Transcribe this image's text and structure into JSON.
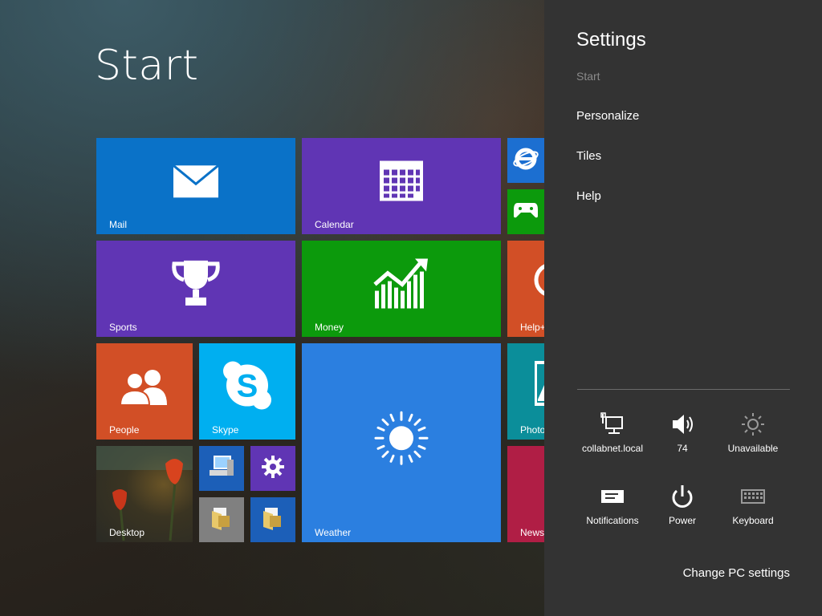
{
  "start": {
    "title": "Start"
  },
  "tiles": {
    "mail": {
      "label": "Mail",
      "color": "#0a72c8"
    },
    "calendar": {
      "label": "Calendar",
      "color": "#6035b4"
    },
    "sports": {
      "label": "Sports",
      "color": "#6035b4"
    },
    "money": {
      "label": "Money",
      "color": "#0c9a0c"
    },
    "people": {
      "label": "People",
      "color": "#d24f26"
    },
    "skype": {
      "label": "Skype",
      "color": "#00aff0"
    },
    "weather": {
      "label": "Weather",
      "color": "#2b7fe0"
    },
    "desktop": {
      "label": "Desktop"
    },
    "help": {
      "label": "Help+"
    },
    "photos": {
      "label": "Photo"
    },
    "news": {
      "label": "News"
    },
    "ie": {
      "icon": "internet-explorer-icon"
    },
    "xbox": {
      "icon": "xbox-games-icon"
    },
    "computer": {
      "icon": "computer-icon"
    },
    "settings": {
      "icon": "gear-icon"
    },
    "explorer1": {
      "icon": "folder-icon"
    },
    "explorer2": {
      "icon": "folder-icon"
    }
  },
  "settings_panel": {
    "title": "Settings",
    "context": "Start",
    "items": [
      "Personalize",
      "Tiles",
      "Help"
    ],
    "quick_settings": [
      {
        "label": "collabnet.local",
        "icon": "network-icon"
      },
      {
        "label": "74",
        "icon": "volume-icon"
      },
      {
        "label": "Unavailable",
        "icon": "brightness-icon"
      },
      {
        "label": "Notifications",
        "icon": "notifications-icon"
      },
      {
        "label": "Power",
        "icon": "power-icon"
      },
      {
        "label": "Keyboard",
        "icon": "keyboard-icon"
      }
    ],
    "change_pc_settings": "Change PC settings"
  }
}
